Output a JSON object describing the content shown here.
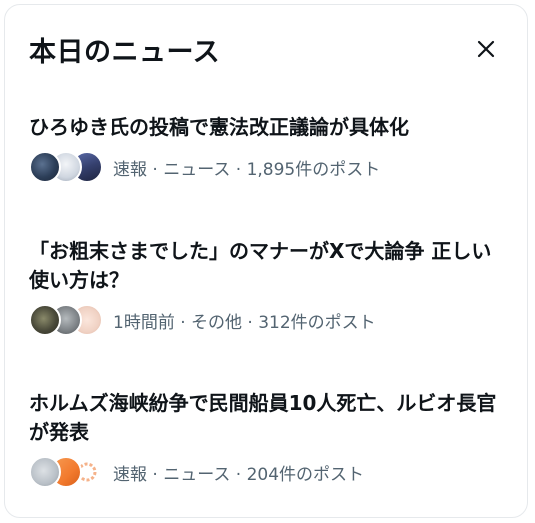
{
  "panel": {
    "title": "本日のニュース",
    "close_icon": "close-icon"
  },
  "items": [
    {
      "headline": "ひろゆき氏の投稿で憲法改正議論が具体化",
      "meta": "速報 · ニュース · 1,895件のポスト",
      "avatar_colors": [
        "#2c3e58",
        "#cfd6e0",
        "#35406e"
      ]
    },
    {
      "headline": "「お粗末さまでした」のマナーがXで大論争 正しい使い方は？",
      "meta": "1時間前 · その他 · 312件のポスト",
      "avatar_colors": [
        "#4a4a3a",
        "#7b8084",
        "#f0d2c4"
      ]
    },
    {
      "headline": "ホルムズ海峡紛争で民間船員10人死亡、ルビオ長官が発表",
      "meta": "速報 · ニュース · 204件のポスト",
      "avatar_colors": [
        "#b9c0c7",
        "#f27a2e",
        "#f5b28a"
      ]
    }
  ]
}
